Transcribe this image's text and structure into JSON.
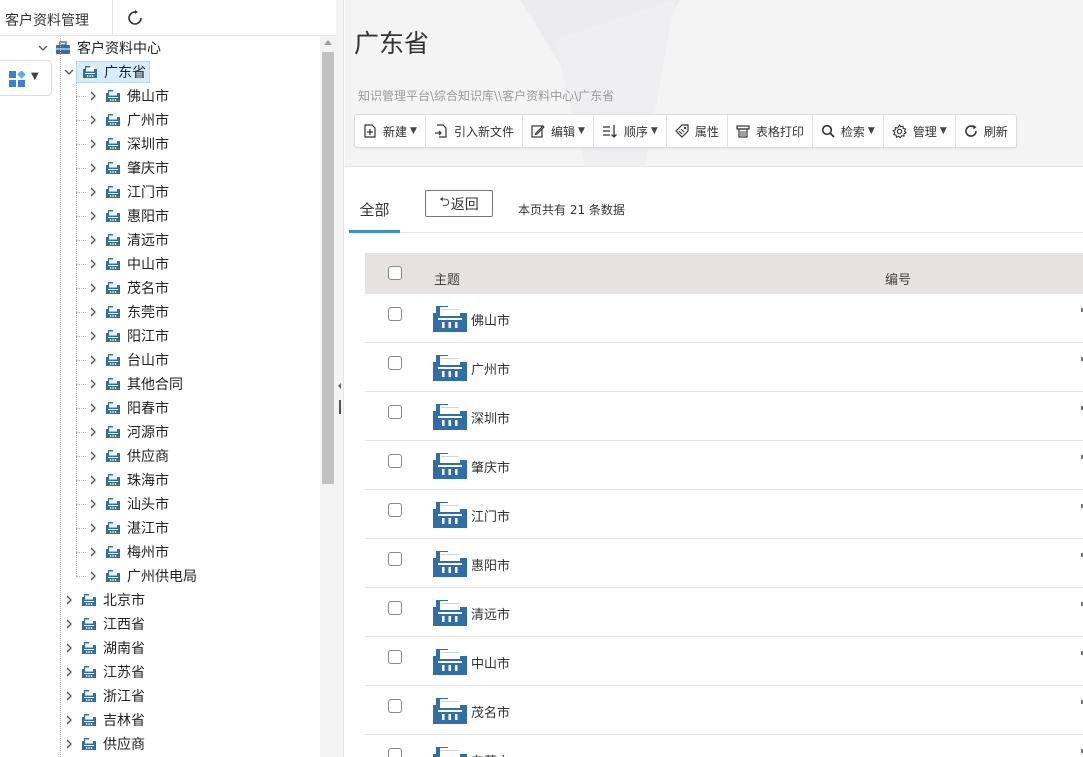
{
  "left": {
    "title": "客户资料管理",
    "tree": [
      {
        "label": "客户资料中心",
        "level": 0,
        "expanded": true,
        "type": "root"
      },
      {
        "label": "广东省",
        "level": 1,
        "expanded": true,
        "selected": true
      },
      {
        "label": "佛山市",
        "level": 2
      },
      {
        "label": "广州市",
        "level": 2
      },
      {
        "label": "深圳市",
        "level": 2
      },
      {
        "label": "肇庆市",
        "level": 2
      },
      {
        "label": "江门市",
        "level": 2
      },
      {
        "label": "惠阳市",
        "level": 2
      },
      {
        "label": "清远市",
        "level": 2
      },
      {
        "label": "中山市",
        "level": 2
      },
      {
        "label": "茂名市",
        "level": 2
      },
      {
        "label": "东莞市",
        "level": 2
      },
      {
        "label": "阳江市",
        "level": 2
      },
      {
        "label": "台山市",
        "level": 2
      },
      {
        "label": "其他合同",
        "level": 2
      },
      {
        "label": "阳春市",
        "level": 2
      },
      {
        "label": "河源市",
        "level": 2
      },
      {
        "label": "供应商",
        "level": 2
      },
      {
        "label": "珠海市",
        "level": 2
      },
      {
        "label": "汕头市",
        "level": 2
      },
      {
        "label": "湛江市",
        "level": 2
      },
      {
        "label": "梅州市",
        "level": 2
      },
      {
        "label": "广州供电局",
        "level": 2
      },
      {
        "label": "北京市",
        "level": 1
      },
      {
        "label": "江西省",
        "level": 1
      },
      {
        "label": "湖南省",
        "level": 1
      },
      {
        "label": "江苏省",
        "level": 1
      },
      {
        "label": "浙江省",
        "level": 1
      },
      {
        "label": "吉林省",
        "level": 1
      },
      {
        "label": "供应商",
        "level": 1
      }
    ]
  },
  "main": {
    "title": "广东省",
    "breadcrumb": "知识管理平台\\综合知识库\\\\客户资料中心\\广东省",
    "toolbar": [
      {
        "label": "新建",
        "icon": "new-file-icon",
        "dropdown": true
      },
      {
        "label": "引入新文件",
        "icon": "import-file-icon",
        "dropdown": false
      },
      {
        "label": "编辑",
        "icon": "edit-icon",
        "dropdown": true
      },
      {
        "label": "顺序",
        "icon": "sort-icon",
        "dropdown": true
      },
      {
        "label": "属性",
        "icon": "tag-icon",
        "dropdown": false
      },
      {
        "label": "表格打印",
        "icon": "print-icon",
        "dropdown": false
      },
      {
        "label": "检索",
        "icon": "search-icon",
        "dropdown": true
      },
      {
        "label": "管理",
        "icon": "gear-icon",
        "dropdown": true
      },
      {
        "label": "刷新",
        "icon": "refresh-icon",
        "dropdown": false
      }
    ],
    "tab_all": "全部",
    "back_label": "返回",
    "record_count": "本页共有 21 条数据",
    "columns": {
      "subject": "主题",
      "number": "编号"
    },
    "rows": [
      "佛山市",
      "广州市",
      "深圳市",
      "肇庆市",
      "江门市",
      "惠阳市",
      "清远市",
      "中山市",
      "茂名市",
      "东莞市"
    ]
  },
  "colors": {
    "folder_blue": "#2f6ea6",
    "accent": "#3a8fd8",
    "selected_bg": "#d6ecfa"
  }
}
